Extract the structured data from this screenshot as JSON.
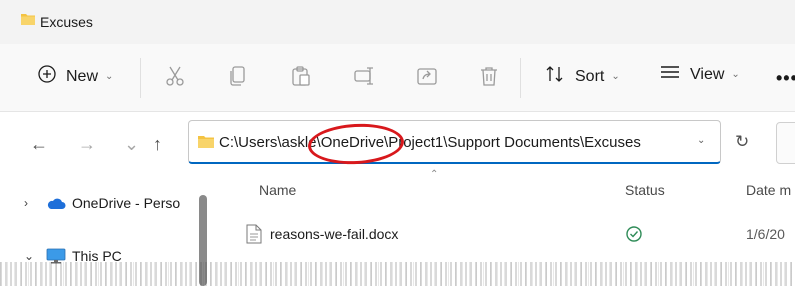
{
  "window": {
    "title": "Excuses"
  },
  "toolbar": {
    "new_label": "New",
    "sort_label": "Sort",
    "view_label": "View",
    "more_label": "•••"
  },
  "address_bar": {
    "path": "C:\\Users\\askle\\OneDrive\\Project1\\Support Documents\\Excuses",
    "highlighted_segment": "OneDrive"
  },
  "sidebar": {
    "items": [
      {
        "label": "OneDrive - Perso",
        "icon": "cloud-icon",
        "expander": "›"
      },
      {
        "label": "This PC",
        "icon": "computer-icon",
        "expander": "⌄"
      }
    ]
  },
  "columns": {
    "name": "Name",
    "status": "Status",
    "date": "Date m"
  },
  "files": [
    {
      "name": "reasons-we-fail.docx",
      "status": "synced-check-icon",
      "date": "1/6/20"
    }
  ],
  "colors": {
    "accent": "#0067c0",
    "folder": "#f4c342",
    "annotation": "#d8181c",
    "status_ok": "#2e8b57",
    "cloud": "#1e6fd9"
  }
}
